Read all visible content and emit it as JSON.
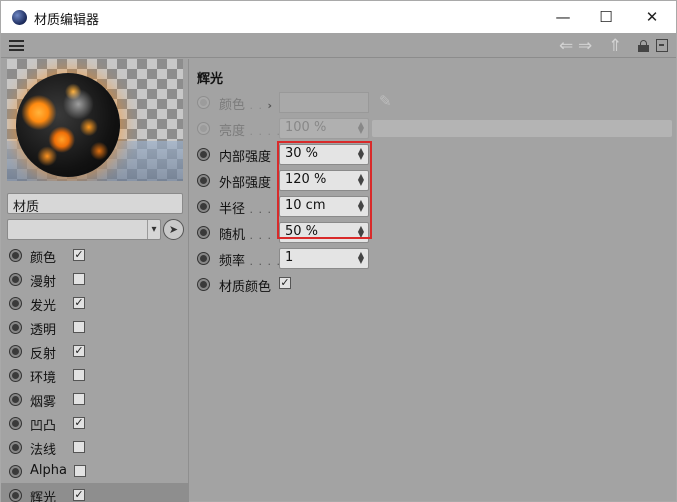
{
  "window": {
    "title": "材质编辑器",
    "minimize": "—",
    "maximize": "☐",
    "close": "✕"
  },
  "toolbar": {
    "icons": [
      "hamburger-menu-icon",
      "back-arrow-icon",
      "forward-arrow-icon",
      "up-arrow-icon",
      "lock-icon",
      "new-window-icon"
    ],
    "back": "⇐",
    "forward": "⇒",
    "up": "⇑"
  },
  "material": {
    "name": "材质",
    "dropdown_value": "",
    "channels": [
      {
        "label": "颜色",
        "checked": true
      },
      {
        "label": "漫射",
        "checked": false
      },
      {
        "label": "发光",
        "checked": true
      },
      {
        "label": "透明",
        "checked": false
      },
      {
        "label": "反射",
        "checked": true
      },
      {
        "label": "环境",
        "checked": false
      },
      {
        "label": "烟雾",
        "checked": false
      },
      {
        "label": "凹凸",
        "checked": true
      },
      {
        "label": "法线",
        "checked": false
      },
      {
        "label": "Alpha",
        "checked": false
      },
      {
        "label": "辉光",
        "checked": true,
        "selected": true
      }
    ]
  },
  "glow": {
    "section_title": "辉光",
    "color_label": "颜色",
    "brightness_label": "亮度",
    "brightness_value": "100 %",
    "inner_label": "内部强度",
    "inner_value": "30 %",
    "outer_label": "外部强度",
    "outer_value": "120 %",
    "radius_label": "半径",
    "radius_value": "10 cm",
    "random_label": "随机",
    "random_value": "50 %",
    "frequency_label": "频率",
    "frequency_value": "1",
    "material_color_label": "材质颜色",
    "material_color_checked": true
  },
  "colors": {
    "panel_bg": "#a3a3a3",
    "highlight_border": "#d92a2a",
    "glow_orange": "#ff8a10"
  }
}
